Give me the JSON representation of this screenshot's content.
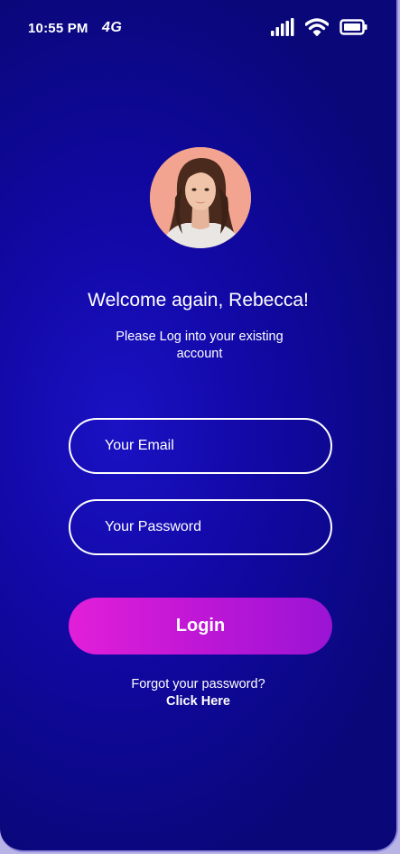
{
  "status_bar": {
    "time": "10:55 PM",
    "network": "4G",
    "icons": [
      "signal-icon",
      "wifi-icon",
      "battery-icon"
    ]
  },
  "profile": {
    "avatar_icon": "user-avatar",
    "welcome": "Welcome again, Rebecca!",
    "subtitle": "Please Log into your existing account"
  },
  "form": {
    "email_placeholder": "Your Email",
    "password_placeholder": "Your Password",
    "login_label": "Login"
  },
  "footer": {
    "forgot_text": "Forgot your password?",
    "click_here": "Click Here"
  },
  "colors": {
    "background": "#1309a8",
    "login_gradient_start": "#e21fd8",
    "login_gradient_end": "#9a14d4",
    "text": "#ffffff"
  }
}
